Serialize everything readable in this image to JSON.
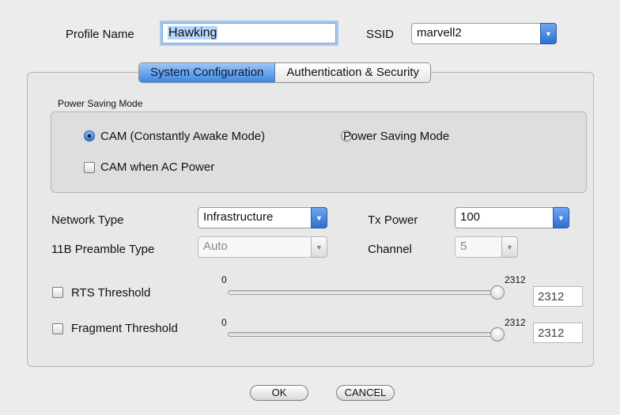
{
  "profile": {
    "label": "Profile Name",
    "value": "Hawking"
  },
  "ssid": {
    "label": "SSID",
    "value": "marvell2"
  },
  "tabs": [
    {
      "label": "System Configuration",
      "active": true
    },
    {
      "label": "Authentication & Security",
      "active": false
    }
  ],
  "power_saving": {
    "group_title": "Power Saving Mode",
    "options": [
      {
        "label": "CAM (Constantly Awake Mode)",
        "selected": true
      },
      {
        "label": "Power Saving Mode",
        "selected": false
      }
    ],
    "cam_ac_label": "CAM when AC Power",
    "cam_ac_checked": false
  },
  "network_type": {
    "label": "Network Type",
    "value": "Infrastructure"
  },
  "tx_power": {
    "label": "Tx Power",
    "value": "100"
  },
  "preamble": {
    "label": "11B Preamble Type",
    "value": "Auto",
    "enabled": false
  },
  "channel": {
    "label": "Channel",
    "value": "5",
    "enabled": false
  },
  "rts": {
    "label": "RTS Threshold",
    "checked": false,
    "min": "0",
    "max": "2312",
    "value": "2312"
  },
  "fragment": {
    "label": "Fragment Threshold",
    "checked": false,
    "min": "0",
    "max": "2312",
    "value": "2312"
  },
  "buttons": {
    "ok": "OK",
    "cancel": "CANCEL"
  },
  "colors": {
    "accent": "#3e86e2",
    "focus_ring": "#a7c7ef",
    "background": "#ececec"
  },
  "icons": {
    "popup_arrow": "chevron-down-icon"
  }
}
